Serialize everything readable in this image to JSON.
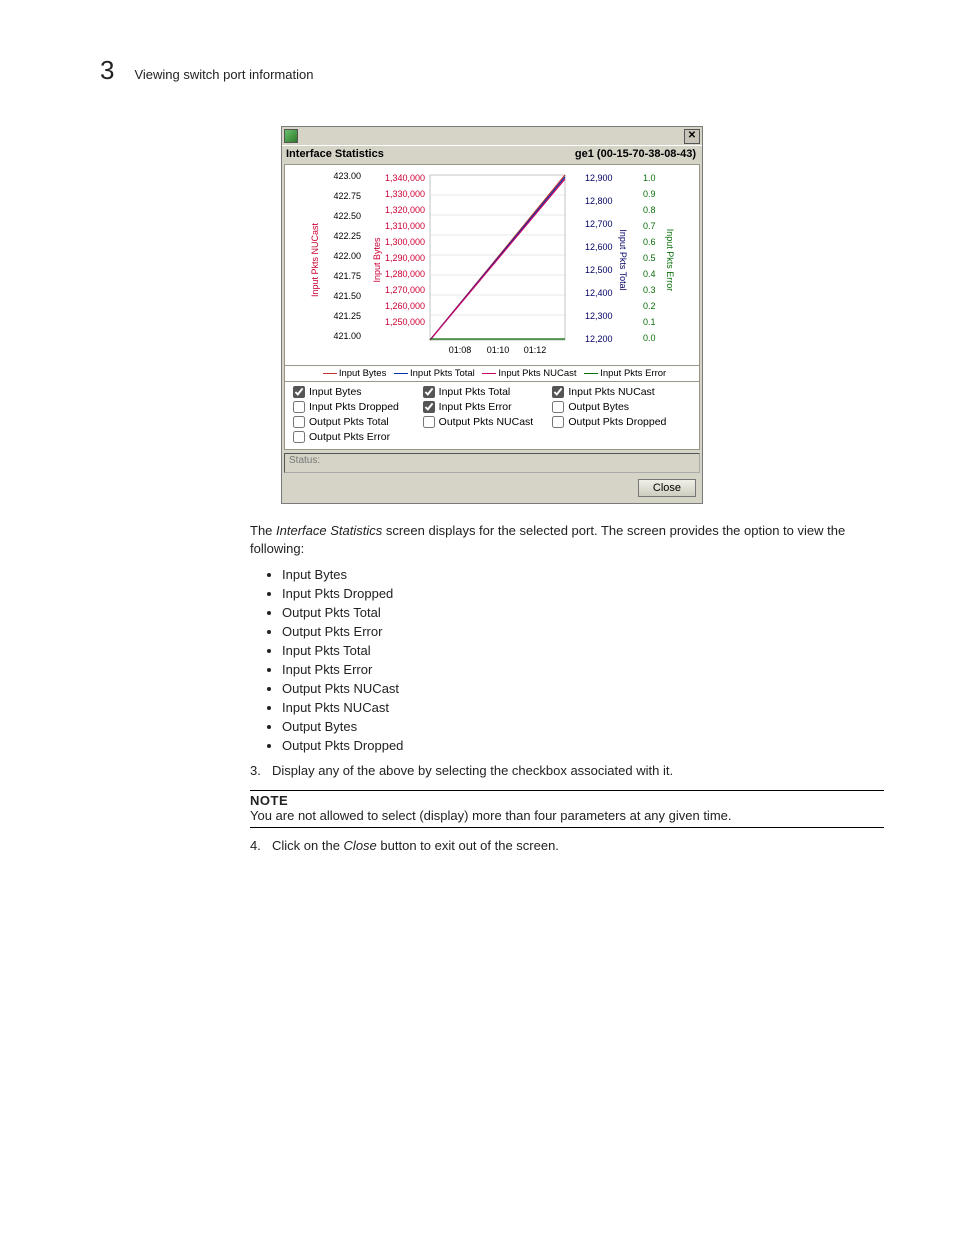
{
  "header": {
    "chapter_number": "3",
    "section_title": "Viewing switch port information"
  },
  "dialog": {
    "window_title": "Interface Statistics",
    "interface_id": "ge1 (00-15-70-38-08-43)",
    "status_label": "Status:",
    "close_button": "Close",
    "legend": {
      "s1": "Input Bytes",
      "s2": "Input Pkts Total",
      "s3": "Input Pkts NUCast",
      "s4": "Input Pkts Error"
    },
    "checkboxes": [
      {
        "label": "Input Bytes",
        "checked": true
      },
      {
        "label": "Input Pkts Total",
        "checked": true
      },
      {
        "label": "Input Pkts NUCast",
        "checked": true
      },
      {
        "label": "Input Pkts Dropped",
        "checked": false
      },
      {
        "label": "Input Pkts Error",
        "checked": true
      },
      {
        "label": "Output Bytes",
        "checked": false
      },
      {
        "label": "Output Pkts Total",
        "checked": false
      },
      {
        "label": "Output Pkts NUCast",
        "checked": false
      },
      {
        "label": "Output Pkts Dropped",
        "checked": false
      },
      {
        "label": "Output Pkts Error",
        "checked": false
      }
    ]
  },
  "chart_data": {
    "type": "line",
    "x_ticks": [
      "01:08",
      "01:10",
      "01:12"
    ],
    "left_axis_1": {
      "label": "Input Pkts NUCast",
      "color": "#cc0066",
      "ticks": [
        "421.00",
        "421.25",
        "421.50",
        "421.75",
        "422.00",
        "422.25",
        "422.50",
        "422.75",
        "423.00"
      ]
    },
    "left_axis_2": {
      "label": "Input Bytes",
      "color": "#c03030",
      "ticks": [
        "1,250,000",
        "1,260,000",
        "1,270,000",
        "1,280,000",
        "1,290,000",
        "1,300,000",
        "1,310,000",
        "1,320,000",
        "1,330,000",
        "1,340,000"
      ]
    },
    "right_axis_1": {
      "label": "Input Pkts Total",
      "color": "#0033aa",
      "ticks": [
        "12,200",
        "12,300",
        "12,400",
        "12,500",
        "12,600",
        "12,700",
        "12,800",
        "12,900"
      ]
    },
    "right_axis_2": {
      "label": "Input Pkts Error",
      "color": "#0a6e0a",
      "ticks": [
        "0.0",
        "0.1",
        "0.2",
        "0.3",
        "0.4",
        "0.5",
        "0.6",
        "0.7",
        "0.8",
        "0.9",
        "1.0"
      ]
    },
    "series": [
      {
        "name": "Input Bytes",
        "color": "#c03030",
        "x": [
          "01:06",
          "01:12"
        ],
        "y": [
          1250000,
          1340000
        ]
      },
      {
        "name": "Input Pkts Total",
        "color": "#0033aa",
        "x": [
          "01:06",
          "01:12"
        ],
        "y": [
          12200,
          12900
        ]
      },
      {
        "name": "Input Pkts NUCast",
        "color": "#cc0066",
        "x": [
          "01:06",
          "01:12"
        ],
        "y": [
          421.0,
          423.0
        ]
      },
      {
        "name": "Input Pkts Error",
        "color": "#0a6e0a",
        "x": [
          "01:06",
          "01:12"
        ],
        "y": [
          0,
          0
        ]
      }
    ]
  },
  "body": {
    "intro_1": "The ",
    "intro_em": "Interface Statistics",
    "intro_2": " screen displays for the selected port. The screen provides the option to view   the following:",
    "bullets": [
      "Input Bytes",
      "Input Pkts Dropped",
      "Output Pkts Total",
      "Output Pkts Error",
      "Input Pkts Total",
      "Input Pkts Error",
      "Output Pkts NUCast",
      "Input Pkts NUCast",
      "Output Bytes",
      "Output Pkts Dropped"
    ],
    "step3_num": "3.",
    "step3_text": "Display any of the above by selecting the checkbox associated with it.",
    "note_head": "NOTE",
    "note_text": "You are not allowed to select (display) more than four parameters at any given time.",
    "step4_num": "4.",
    "step4_text_1": "Click on the ",
    "step4_em": "Close",
    "step4_text_2": " button to exit out of the screen."
  }
}
